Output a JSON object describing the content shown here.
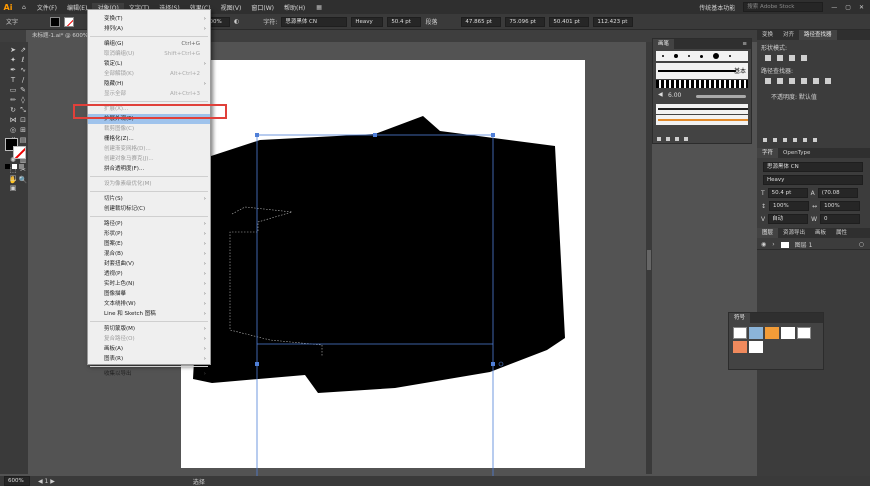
{
  "menubar": {
    "logo": "Ai",
    "items": [
      "文件(F)",
      "编辑(E)",
      "对象(O)",
      "文字(T)",
      "选择(S)",
      "效果(C)",
      "视图(V)",
      "窗口(W)",
      "帮助(H)"
    ],
    "workspace": "传统基本功能",
    "search_placeholder": "搜索 Adobe Stock"
  },
  "control": {
    "label": "文字",
    "zoom": "100%",
    "font": "思源黑体 CN",
    "style": "Heavy",
    "size": "50.4 pt",
    "para": "段落",
    "x": "47.865 pt",
    "y": "75.096 pt",
    "w": "50.401 pt",
    "h": "112.423 pt"
  },
  "doc_tab": "未标题-1.ai* @ 600% (CMYK/GPU 预览)",
  "status": {
    "zoom": "600%",
    "tool": "选择"
  },
  "menu": [
    {
      "label": "变换(T)",
      "arrow": true
    },
    {
      "label": "排列(A)",
      "arrow": true
    },
    {
      "sep": true
    },
    {
      "label": "编组(G)",
      "shortcut": "Ctrl+G"
    },
    {
      "label": "取消编组(U)",
      "shortcut": "Shift+Ctrl+G",
      "disabled": true
    },
    {
      "label": "锁定(L)",
      "arrow": true
    },
    {
      "label": "全部解锁(K)",
      "shortcut": "Alt+Ctrl+2",
      "disabled": true
    },
    {
      "label": "隐藏(H)",
      "arrow": true
    },
    {
      "label": "显示全部",
      "shortcut": "Alt+Ctrl+3",
      "disabled": true
    },
    {
      "sep": true
    },
    {
      "label": "扩展(X)...",
      "disabled": true
    },
    {
      "label": "扩展外观(E)",
      "highlighted": true
    },
    {
      "label": "裁剪图像(C)",
      "disabled": true
    },
    {
      "label": "栅格化(Z)..."
    },
    {
      "label": "创建渐变网格(D)...",
      "disabled": true
    },
    {
      "label": "创建对象马赛克(J)...",
      "disabled": true
    },
    {
      "label": "拼合透明度(F)..."
    },
    {
      "sep": true
    },
    {
      "label": "设为像素级优化(M)",
      "disabled": true
    },
    {
      "sep": true
    },
    {
      "label": "切片(S)",
      "arrow": true
    },
    {
      "label": "创建裁切标记(C)"
    },
    {
      "sep": true
    },
    {
      "label": "路径(P)",
      "arrow": true
    },
    {
      "label": "形状(P)",
      "arrow": true
    },
    {
      "label": "图案(E)",
      "arrow": true
    },
    {
      "label": "混合(B)",
      "arrow": true
    },
    {
      "label": "封套扭曲(V)",
      "arrow": true
    },
    {
      "label": "透视(P)",
      "arrow": true
    },
    {
      "label": "实时上色(N)",
      "arrow": true
    },
    {
      "label": "图像描摹",
      "arrow": true
    },
    {
      "label": "文本绕排(W)",
      "arrow": true
    },
    {
      "label": "Line 和 Sketch 图稿",
      "arrow": true
    },
    {
      "sep": true
    },
    {
      "label": "剪切蒙版(M)",
      "arrow": true
    },
    {
      "label": "复合路径(O)",
      "arrow": true,
      "disabled": true
    },
    {
      "label": "画板(A)",
      "arrow": true
    },
    {
      "label": "图表(R)",
      "arrow": true
    },
    {
      "sep": true
    },
    {
      "label": "收集以导出",
      "arrow": true
    }
  ],
  "brushes": {
    "title": "画笔",
    "basic": "基本",
    "size": "6.00"
  },
  "pathfinder": {
    "tabs": [
      "变换",
      "对齐",
      "路径查找器"
    ],
    "shape_modes": "形状模式:",
    "pathfinder_label": "路径查找器:",
    "opacity": "不透明度: 默认值"
  },
  "character": {
    "tabs": [
      "字符",
      "OpenType"
    ],
    "font": "思源黑体 CN",
    "style": "Heavy",
    "size": "50.4 pt",
    "leading": "(70.08",
    "scale_h": "100%",
    "scale_v": "100%",
    "tracking": "自动",
    "kerning": "0"
  },
  "layers": {
    "tabs": [
      "图层",
      "资源导出",
      "画板",
      "属性"
    ],
    "layer_name": "图层 1"
  },
  "symbols": {
    "title": "符号"
  }
}
